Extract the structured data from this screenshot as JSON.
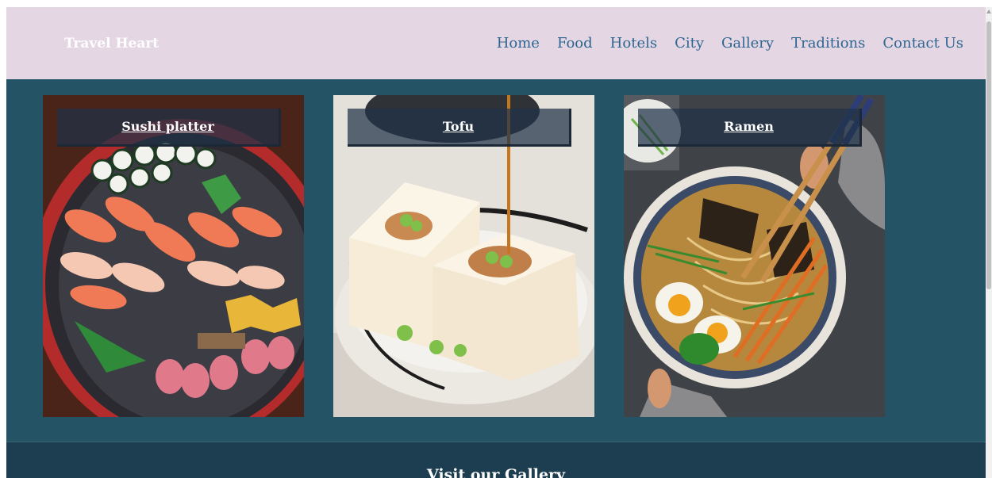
{
  "navbar": {
    "brand": "Travel Heart",
    "links": [
      "Home",
      "Food",
      "Hotels",
      "City",
      "Gallery",
      "Traditions",
      "Contact Us"
    ]
  },
  "cards": [
    {
      "label": "Sushi platter"
    },
    {
      "label": "Tofu"
    },
    {
      "label": "Ramen"
    }
  ],
  "gallery": {
    "title": "Visit our Gallery"
  },
  "colors": {
    "navbar_bg": "#e4d7e3",
    "nav_link": "#2f6591",
    "page_bg": "#245365",
    "footer_bg": "#1c3e50"
  }
}
